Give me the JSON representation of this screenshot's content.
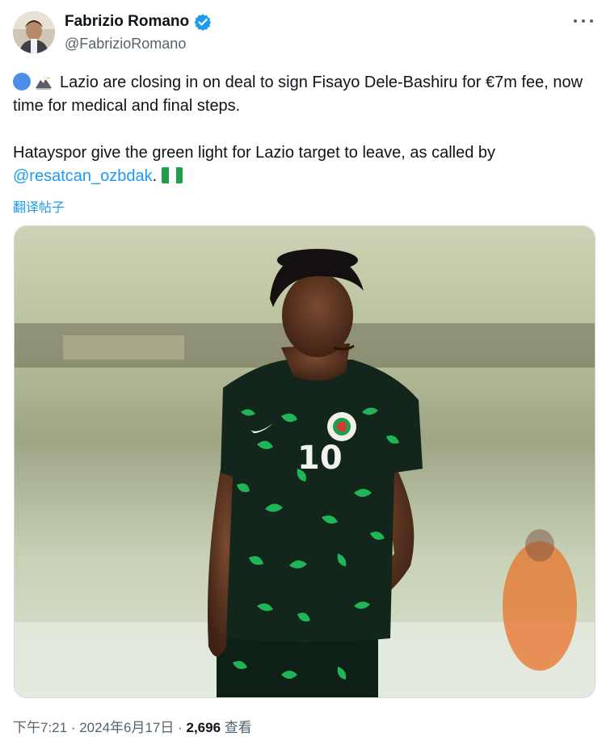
{
  "author": {
    "display_name": "Fabrizio Romano",
    "handle": "@FabrizioRomano",
    "verified": true
  },
  "tweet": {
    "line1": "Lazio are closing in on deal to sign Fisayo Dele-Bashiru for €7m fee, now time for medical and final steps.",
    "line2_before": "Hatayspor give the green light for Lazio target to leave, as called by ",
    "mention": "@resatcan_ozbdak",
    "line2_after": ".",
    "emojis": [
      "blue-circle",
      "eagle",
      "flag-nigeria"
    ]
  },
  "translate_label": "翻译帖子",
  "media": {
    "description_icon": "photo-football-player",
    "shirt_number": "10"
  },
  "meta": {
    "time": "下午7:21",
    "separator": " · ",
    "date": "2024年6月17日",
    "views_count": "2,696",
    "views_label": "查看"
  },
  "colors": {
    "accent": "#1d9bf0",
    "text": "#0f1419",
    "muted": "#536471",
    "jersey": "#12261b",
    "jersey_pattern": "#22c55e"
  }
}
